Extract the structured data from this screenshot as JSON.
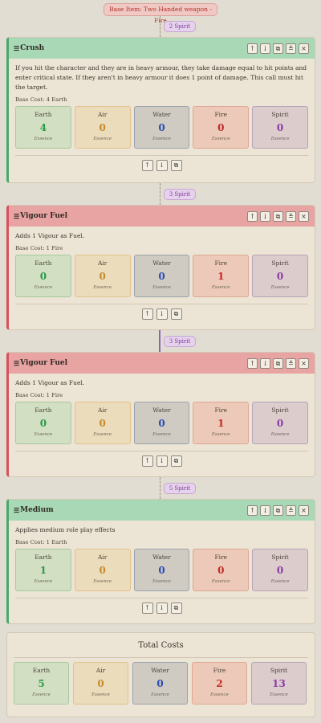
{
  "base_item": "Base Item: Two Handed weapon - Fire",
  "essence_sublabel": "Essence",
  "essence_labels": [
    "Earth",
    "Air",
    "Water",
    "Fire",
    "Spirit"
  ],
  "connectors": [
    "2 Spirit",
    "3 Spirit",
    "3 Spirit",
    "5 Spirit"
  ],
  "cards": [
    {
      "title": "Crush",
      "color": "green",
      "description": "If you hit the character and they are in heavy armour, they take damage equal to hit points and enter critical state. If they aren't in heavy armour it does 1 point of damage. This call must hit the target.",
      "base_cost": "Base Cost: 4 Earth",
      "values": [
        "4",
        "0",
        "0",
        "0",
        "0"
      ]
    },
    {
      "title": "Vigour Fuel",
      "color": "red",
      "description": "Adds 1 Vigour as Fuel.",
      "base_cost": "Base Cost: 1 Fire",
      "values": [
        "0",
        "0",
        "0",
        "1",
        "0"
      ]
    },
    {
      "title": "Vigour Fuel",
      "color": "red",
      "description": "Adds 1 Vigour as Fuel.",
      "base_cost": "Base Cost: 1 Fire",
      "values": [
        "0",
        "0",
        "0",
        "1",
        "0"
      ]
    },
    {
      "title": "Medium",
      "color": "green",
      "description": "Applies medium role play effects",
      "base_cost": "Base Cost: 1 Earth",
      "values": [
        "1",
        "0",
        "0",
        "0",
        "0"
      ]
    }
  ],
  "totals": {
    "title": "Total Costs",
    "values": [
      "5",
      "0",
      "0",
      "2",
      "13"
    ]
  },
  "icons": {
    "drag": "drag-handle-icon",
    "up": "arrow-up-icon",
    "down": "arrow-down-icon",
    "copy": "copy-icon",
    "collapse": "collapse-icon",
    "close": "close-icon"
  }
}
